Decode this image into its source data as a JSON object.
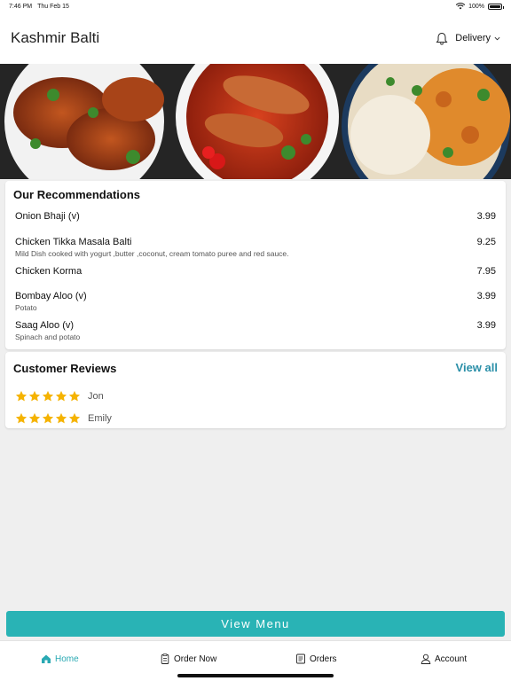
{
  "status_bar": {
    "time": "7:46 PM",
    "date": "Thu Feb 15",
    "battery": "100%"
  },
  "header": {
    "title": "Kashmir Balti",
    "delivery_label": "Delivery"
  },
  "recommendations": {
    "title": "Our Recommendations",
    "items": [
      {
        "name": "Onion Bhaji (v)",
        "description": "",
        "price": "3.99"
      },
      {
        "name": "Chicken Tikka Masala Balti",
        "description": "Mild Dish cooked with yogurt ,butter ,coconut, cream tomato puree and red sauce.",
        "price": "9.25"
      },
      {
        "name": "Chicken Korma",
        "description": "",
        "price": "7.95"
      },
      {
        "name": "Bombay Aloo (v)",
        "description": "Potato",
        "price": "3.99"
      },
      {
        "name": "Saag Aloo (v)",
        "description": "Spinach and potato",
        "price": "3.99"
      }
    ]
  },
  "reviews": {
    "title": "Customer Reviews",
    "view_all": "View all",
    "items": [
      {
        "name": "Jon",
        "stars": 5
      },
      {
        "name": "Emily",
        "stars": 5
      }
    ]
  },
  "view_menu_label": "View Menu",
  "tabs": [
    {
      "label": "Home",
      "icon": "home-icon",
      "active": true
    },
    {
      "label": "Order Now",
      "icon": "clipboard-icon",
      "active": false
    },
    {
      "label": "Orders",
      "icon": "receipt-icon",
      "active": false
    },
    {
      "label": "Account",
      "icon": "user-icon",
      "active": false
    }
  ],
  "colors": {
    "accent": "#29b3b5",
    "link": "#2a8fa8",
    "star": "#f5b301"
  }
}
